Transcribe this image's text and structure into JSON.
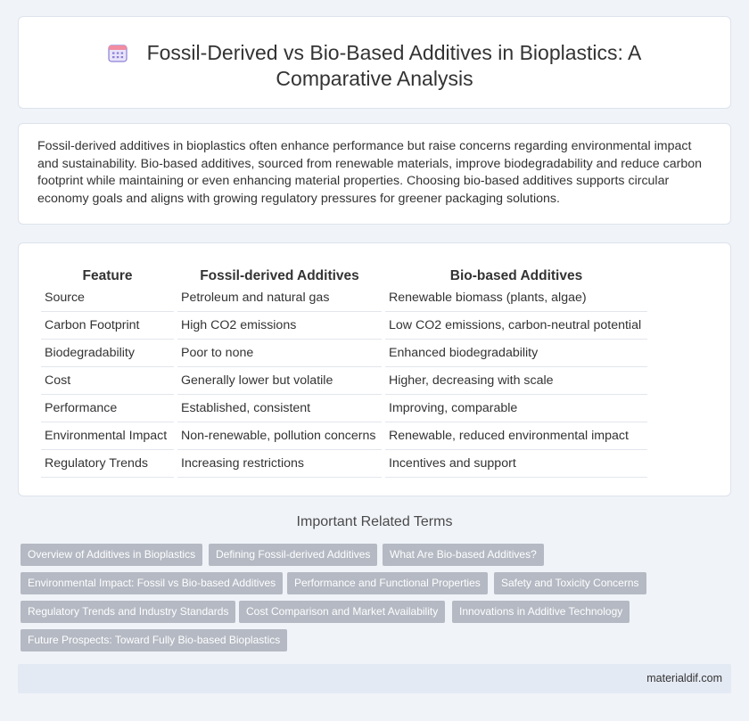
{
  "header": {
    "title_line1": "Fossil-Derived vs Bio-Based Additives in Bioplastics: A",
    "title_line2": "Comparative Analysis",
    "icon": "calendar-icon"
  },
  "intro": {
    "text": "Fossil-derived additives in bioplastics often enhance performance but raise concerns regarding environmental impact and sustainability. Bio-based additives, sourced from renewable materials, improve biodegradability and reduce carbon footprint while maintaining or even enhancing material properties. Choosing bio-based additives supports circular economy goals and aligns with growing regulatory pressures for greener packaging solutions."
  },
  "table": {
    "headers": [
      "Feature",
      "Fossil-derived Additives",
      "Bio-based Additives"
    ],
    "rows": [
      [
        "Source",
        "Petroleum and natural gas",
        "Renewable biomass (plants, algae)"
      ],
      [
        "Carbon Footprint",
        "High CO2 emissions",
        "Low CO2 emissions, carbon-neutral potential"
      ],
      [
        "Biodegradability",
        "Poor to none",
        "Enhanced biodegradability"
      ],
      [
        "Cost",
        "Generally lower but volatile",
        "Higher, decreasing with scale"
      ],
      [
        "Performance",
        "Established, consistent",
        "Improving, comparable"
      ],
      [
        "Environmental Impact",
        "Non-renewable, pollution concerns",
        "Renewable, reduced environmental impact"
      ],
      [
        "Regulatory Trends",
        "Increasing restrictions",
        "Incentives and support"
      ]
    ]
  },
  "related": {
    "title": "Important Related Terms",
    "tags": [
      "Overview of Additives in Bioplastics",
      "Defining Fossil-derived Additives",
      "What Are Bio-based Additives?",
      "Environmental Impact: Fossil vs Bio-based Additives",
      "Performance and Functional Properties",
      "Safety and Toxicity Concerns",
      "Regulatory Trends and Industry Standards",
      "Cost Comparison and Market Availability",
      "Innovations in Additive Technology",
      "Future Prospects: Toward Fully Bio-based Bioplastics"
    ]
  },
  "footer": {
    "site": "materialdif.com"
  },
  "colors": {
    "background": "#f0f3f8",
    "tag_bg": "#b4b9c3",
    "footer_bg": "#e4eaf4",
    "icon_accent": "#8b7fd6"
  }
}
